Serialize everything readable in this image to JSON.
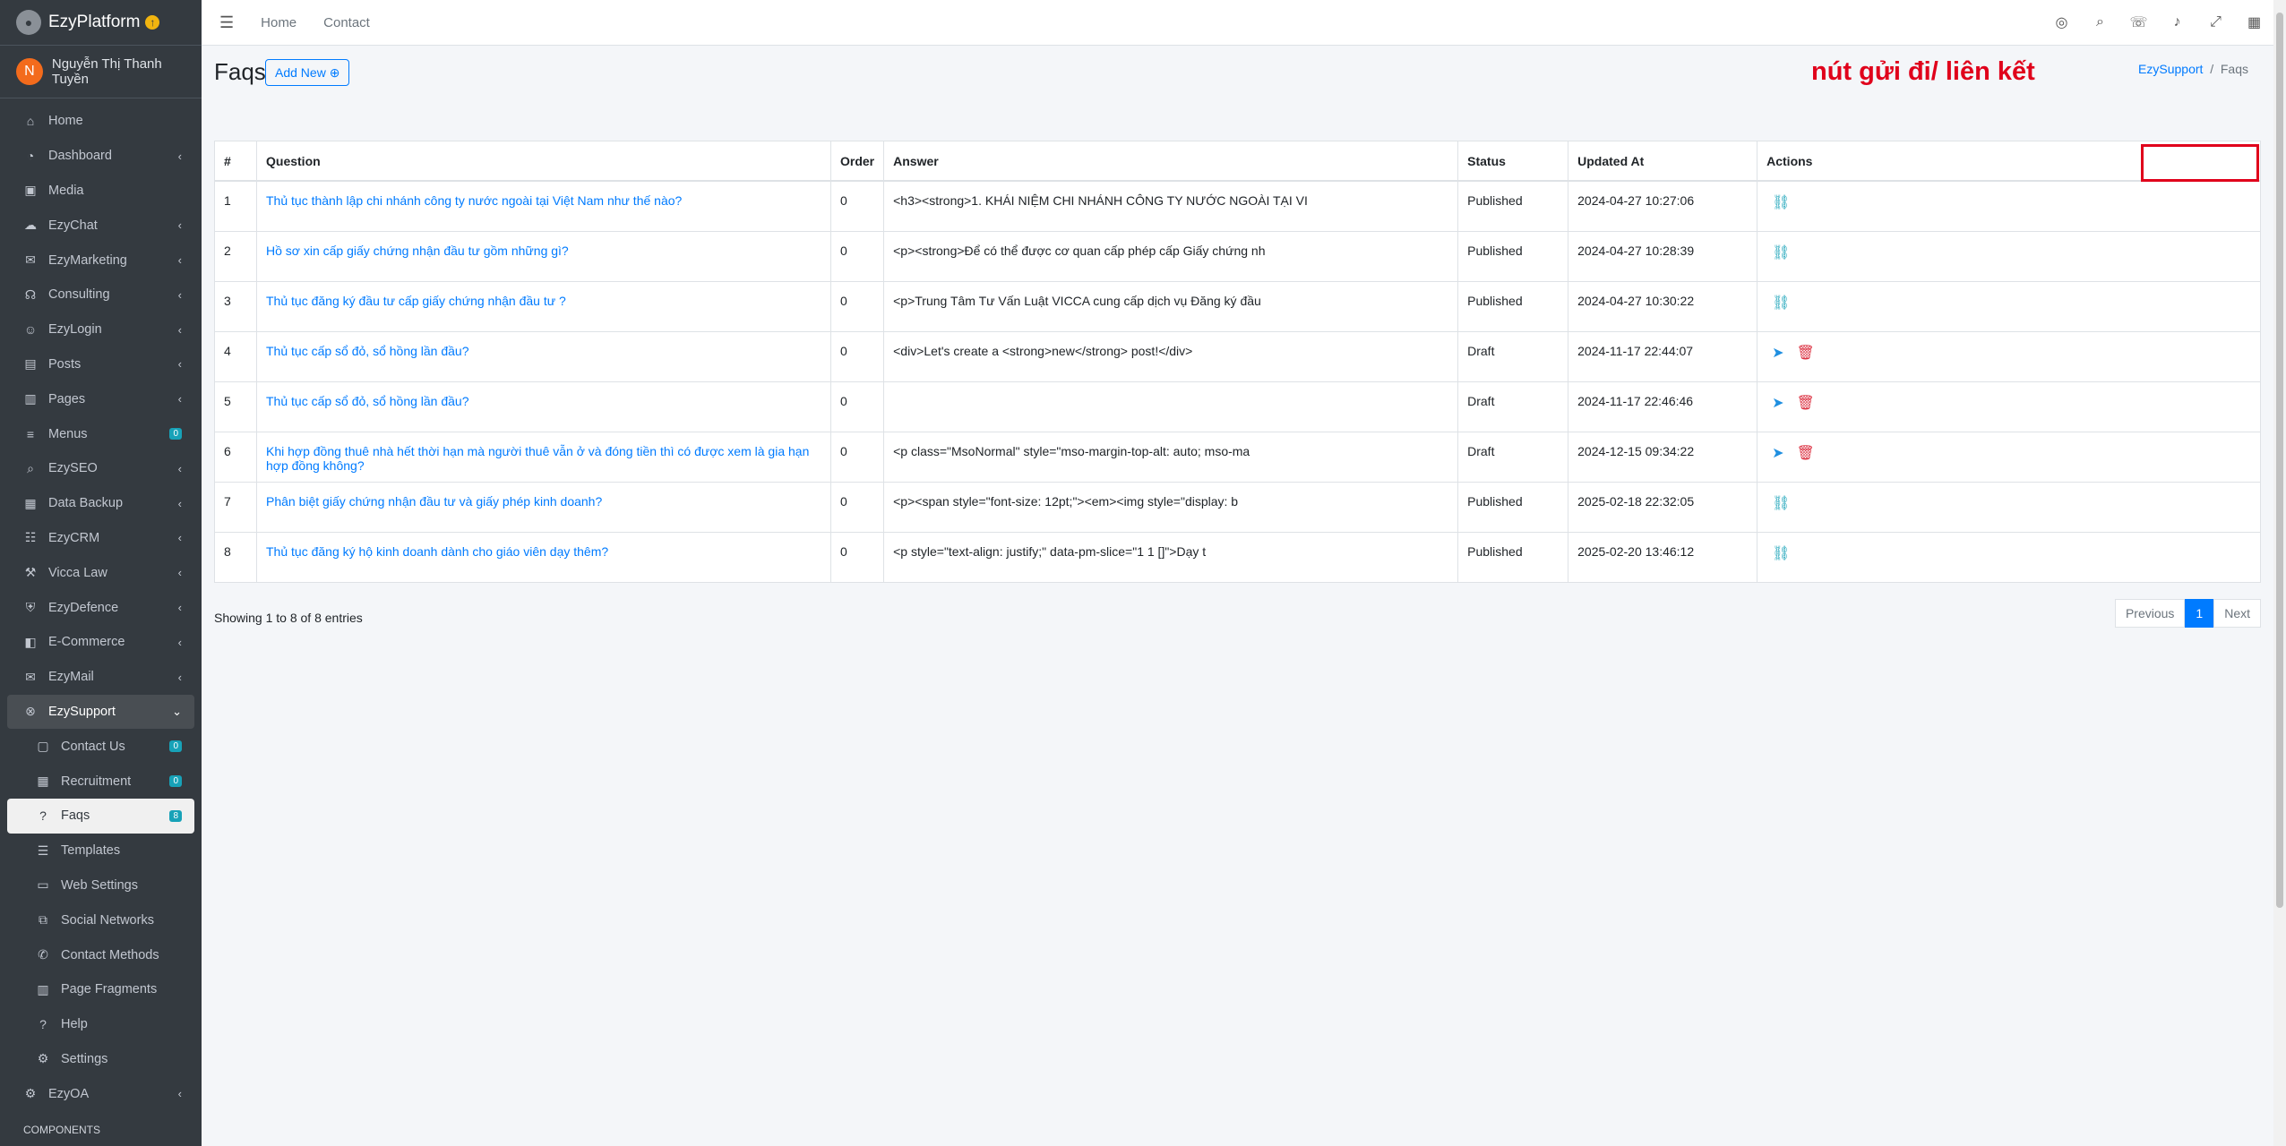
{
  "brand": {
    "name": "EzyPlatform",
    "up_icon": "arrow-up-icon"
  },
  "user": {
    "initial": "N",
    "name": "Nguyễn Thị Thanh Tuyền"
  },
  "sidebar": {
    "items": [
      {
        "label": "Home",
        "icon": "home-icon",
        "glyph": "⌂",
        "arrow": ""
      },
      {
        "label": "Dashboard",
        "icon": "dashboard-icon",
        "glyph": "◔",
        "arrow": "‹"
      },
      {
        "label": "Media",
        "icon": "image-icon",
        "glyph": "▣",
        "arrow": ""
      },
      {
        "label": "EzyChat",
        "icon": "chat-icon",
        "glyph": "☁",
        "arrow": "‹"
      },
      {
        "label": "EzyMarketing",
        "icon": "megaphone-icon",
        "glyph": "✉",
        "arrow": "‹"
      },
      {
        "label": "Consulting",
        "icon": "headset-icon",
        "glyph": "☊",
        "arrow": "‹"
      },
      {
        "label": "EzyLogin",
        "icon": "user-lock-icon",
        "glyph": "☺",
        "arrow": "‹"
      },
      {
        "label": "Posts",
        "icon": "newspaper-icon",
        "glyph": "▤",
        "arrow": "‹"
      },
      {
        "label": "Pages",
        "icon": "columns-icon",
        "glyph": "▥",
        "arrow": "‹"
      },
      {
        "label": "Menus",
        "icon": "bars-icon",
        "glyph": "≡",
        "badge": "0"
      },
      {
        "label": "EzySEO",
        "icon": "search-icon",
        "glyph": "⌕",
        "arrow": "‹"
      },
      {
        "label": "Data Backup",
        "icon": "database-icon",
        "glyph": "▦",
        "arrow": "‹"
      },
      {
        "label": "EzyCRM",
        "icon": "users-icon",
        "glyph": "☷",
        "arrow": "‹"
      },
      {
        "label": "Vicca Law",
        "icon": "gavel-icon",
        "glyph": "⚒",
        "arrow": "‹"
      },
      {
        "label": "EzyDefence",
        "icon": "shield-icon",
        "glyph": "⛨",
        "arrow": "‹"
      },
      {
        "label": "E-Commerce",
        "icon": "bag-icon",
        "glyph": "◧",
        "arrow": "‹"
      },
      {
        "label": "EzyMail",
        "icon": "envelope-icon",
        "glyph": "✉",
        "arrow": "‹"
      }
    ],
    "support": {
      "label": "EzySupport",
      "icon": "lifebuoy-icon",
      "glyph": "⊗",
      "arrow": "⌄"
    },
    "subitems": [
      {
        "label": "Contact Us",
        "icon": "address-card-icon",
        "glyph": "▢",
        "badge": "0"
      },
      {
        "label": "Recruitment",
        "icon": "grid-icon",
        "glyph": "▦",
        "badge": "0"
      },
      {
        "label": "Faqs",
        "icon": "question-circle-icon",
        "glyph": "?",
        "badge": "8"
      },
      {
        "label": "Templates",
        "icon": "table-icon",
        "glyph": "☰"
      },
      {
        "label": "Web Settings",
        "icon": "window-icon",
        "glyph": "▭"
      },
      {
        "label": "Social Networks",
        "icon": "share-icon",
        "glyph": "⧉"
      },
      {
        "label": "Contact Methods",
        "icon": "phone-icon",
        "glyph": "✆"
      },
      {
        "label": "Page Fragments",
        "icon": "columns-icon",
        "glyph": "▥"
      },
      {
        "label": "Help",
        "icon": "help-circle-icon",
        "glyph": "?"
      },
      {
        "label": "Settings",
        "icon": "cogs-icon",
        "glyph": "⚙"
      }
    ],
    "after": [
      {
        "label": "EzyOA",
        "icon": "office-icon",
        "glyph": "⚙",
        "arrow": "‹"
      }
    ],
    "components_header": "COMPONENTS"
  },
  "topbar": {
    "home": "Home",
    "contact": "Contact",
    "icons": [
      "globe-icon",
      "search-icon",
      "comments-icon",
      "bell-icon",
      "expand-icon",
      "apps-icon"
    ]
  },
  "page": {
    "title": "Faqs",
    "add_new": "Add New",
    "breadcrumb_root": "EzySupport",
    "breadcrumb_sep": "/",
    "breadcrumb_current": "Faqs",
    "annotation": "nút gửi đi/ liên kết"
  },
  "table": {
    "headers": [
      "#",
      "Question",
      "Order",
      "Answer",
      "Status",
      "Updated At",
      "Actions"
    ],
    "rows": [
      {
        "n": "1",
        "q": "Thủ tục thành lập chi nhánh công ty nước ngoài tại Việt Nam như thế nào?",
        "order": "0",
        "answer": "<h3><strong>1. KHÁI NIỆM CHI NHÁNH CÔNG TY NƯỚC NGOÀI TẠI VI",
        "status": "Published",
        "updated": "2024-04-27 10:27:06",
        "actions": "unlink"
      },
      {
        "n": "2",
        "q": "Hồ sơ xin cấp giấy chứng nhận đầu tư gồm những gì?",
        "order": "0",
        "answer": "<p><strong>Để có thể được cơ quan cấp phép cấp Giấy chứng nh",
        "status": "Published",
        "updated": "2024-04-27 10:28:39",
        "actions": "unlink"
      },
      {
        "n": "3",
        "q": "Thủ tục đăng ký đầu tư cấp giấy chứng nhận đầu tư ?",
        "order": "0",
        "answer": "<p>Trung Tâm Tư Vấn Luật VICCA  cung cấp dịch vụ Đăng ký đầu",
        "status": "Published",
        "updated": "2024-04-27 10:30:22",
        "actions": "unlink"
      },
      {
        "n": "4",
        "q": "Thủ tục cấp sổ đỏ, sổ hồng lần đầu?",
        "order": "0",
        "answer": "<div>Let's create a <strong>new</strong> post!</div>",
        "status": "Draft",
        "updated": "2024-11-17 22:44:07",
        "actions": "send-delete"
      },
      {
        "n": "5",
        "q": "Thủ tục cấp sổ đỏ, sổ hồng lần đầu?",
        "order": "0",
        "answer": "",
        "status": "Draft",
        "updated": "2024-11-17 22:46:46",
        "actions": "send-delete"
      },
      {
        "n": "6",
        "q": "Khi hợp đồng thuê nhà hết thời hạn mà người thuê vẫn ở và đóng tiền thì có được xem là gia hạn hợp đồng không?",
        "order": "0",
        "answer": "<p class=\"MsoNormal\" style=\"mso-margin-top-alt: auto; mso-ma",
        "status": "Draft",
        "updated": "2024-12-15 09:34:22",
        "actions": "send-delete"
      },
      {
        "n": "7",
        "q": "Phân biệt giấy chứng nhận đầu tư và giấy phép kinh doanh?",
        "order": "0",
        "answer": "<p><span style=\"font-size: 12pt;\"><em><img style=\"display: b",
        "status": "Published",
        "updated": "2025-02-18 22:32:05",
        "actions": "unlink"
      },
      {
        "n": "8",
        "q": "Thủ tục đăng ký hộ kinh doanh dành cho giáo viên dạy thêm?",
        "order": "0",
        "answer": "<p style=\"text-align: justify;\" data-pm-slice=\"1 1 []\">Dạy t",
        "status": "Published",
        "updated": "2025-02-20 13:46:12",
        "actions": "unlink"
      }
    ]
  },
  "footer": {
    "showing": "Showing 1 to 8 of 8 entries",
    "prev": "Previous",
    "page": "1",
    "next": "Next"
  }
}
